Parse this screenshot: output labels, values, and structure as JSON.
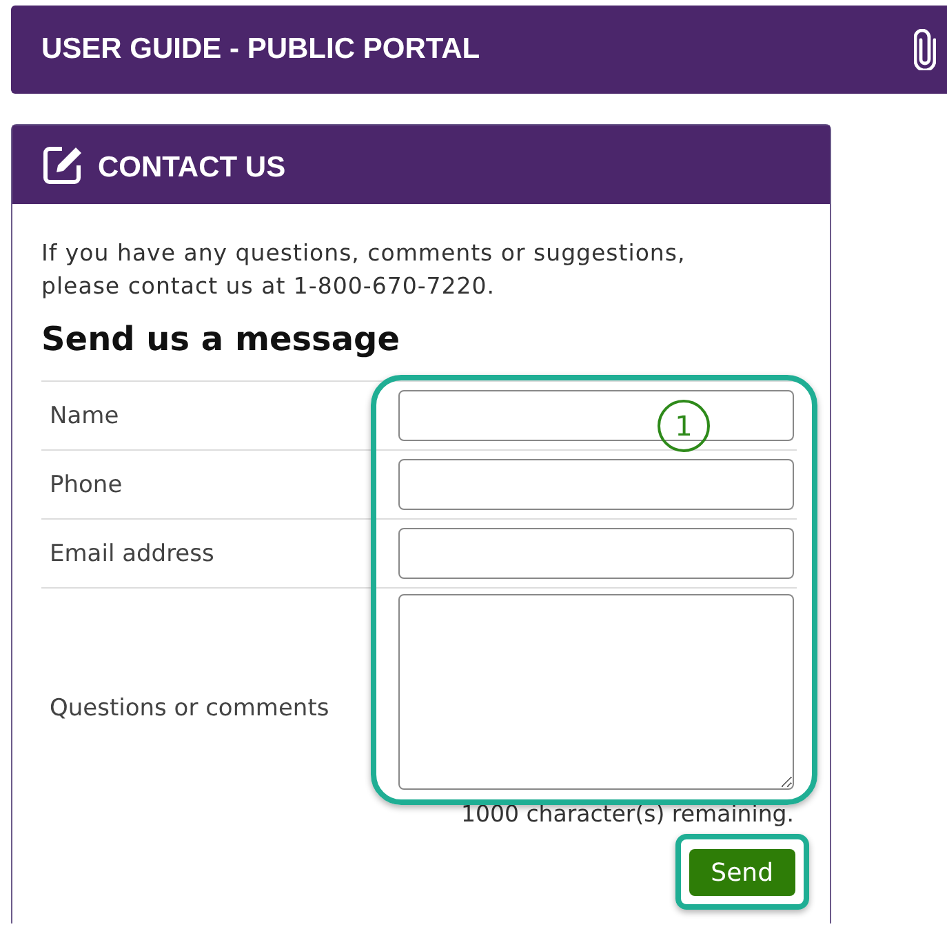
{
  "banner": {
    "title": "USER GUIDE - PUBLIC PORTAL"
  },
  "card": {
    "title": "CONTACT US",
    "intro": "If you have any questions, comments or suggestions, please contact us at 1-800-670-7220.",
    "heading": "Send us a message",
    "fields": [
      {
        "label": "Name",
        "kind": "input"
      },
      {
        "label": "Phone",
        "kind": "input"
      },
      {
        "label": "Email address",
        "kind": "input"
      },
      {
        "label": "Questions or comments",
        "kind": "textarea"
      }
    ],
    "remaining": "1000 character(s) remaining.",
    "send_button": "Send"
  },
  "callout": "1"
}
